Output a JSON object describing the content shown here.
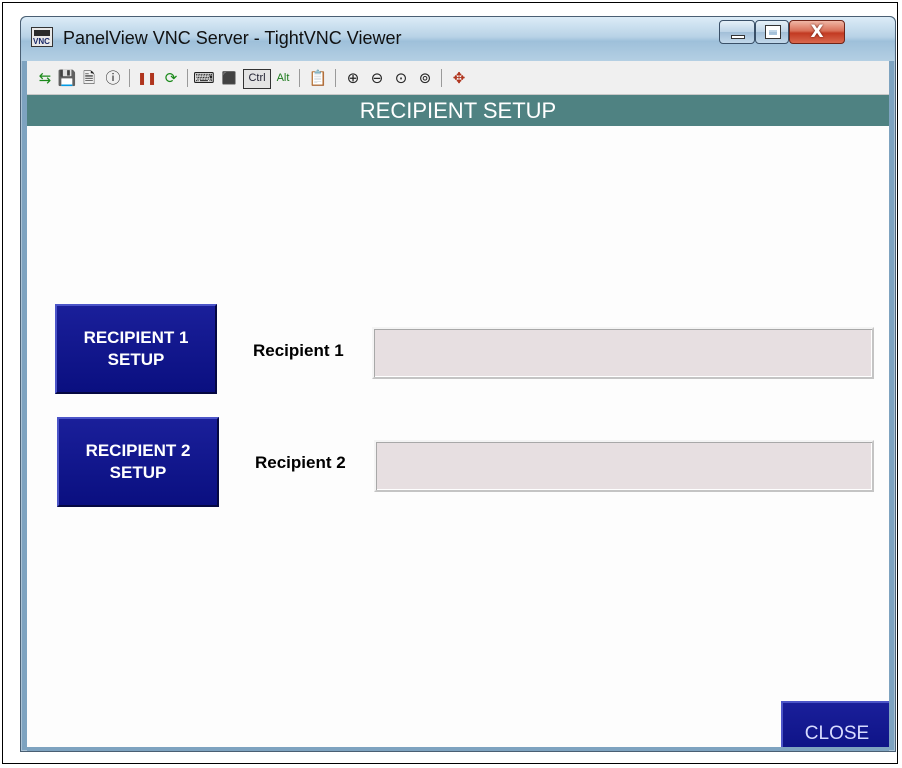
{
  "window": {
    "title": "PanelView VNC Server - TightVNC Viewer",
    "app_icon_text": "VNC",
    "close_glyph": "X"
  },
  "toolbar": {
    "items": [
      {
        "name": "new-connection-icon",
        "glyph": "⇆"
      },
      {
        "name": "save-icon",
        "glyph": "💾"
      },
      {
        "name": "options-icon",
        "glyph": "🗎"
      },
      {
        "name": "connection-info-icon",
        "glyph": "ⓘ"
      },
      {
        "name": "pause-icon",
        "glyph": "❚❚"
      },
      {
        "name": "refresh-icon",
        "glyph": "⟳"
      },
      {
        "name": "ctrl-alt-del-icon",
        "glyph": "⌨"
      },
      {
        "name": "send-keys-icon",
        "glyph": "⬛"
      },
      {
        "name": "ctrl-key-button",
        "glyph": "Ctrl"
      },
      {
        "name": "alt-key-button",
        "glyph": "Alt"
      },
      {
        "name": "clipboard-icon",
        "glyph": "📋"
      },
      {
        "name": "zoom-in-icon",
        "glyph": "⊕"
      },
      {
        "name": "zoom-out-icon",
        "glyph": "⊖"
      },
      {
        "name": "zoom-100-icon",
        "glyph": "⊙"
      },
      {
        "name": "zoom-auto-icon",
        "glyph": "⊚"
      },
      {
        "name": "fullscreen-icon",
        "glyph": "✥"
      }
    ]
  },
  "screen": {
    "header": "RECIPIENT SETUP",
    "recipient1": {
      "button_line1": "RECIPIENT 1",
      "button_line2": "SETUP",
      "label": "Recipient 1",
      "value": ""
    },
    "recipient2": {
      "button_line1": "RECIPIENT 2",
      "button_line2": "SETUP",
      "label": "Recipient 2",
      "value": ""
    },
    "close_label": "CLOSE"
  },
  "colors": {
    "header_bg": "#4f8282",
    "button_bg": "#10169a",
    "field_bg": "#e7dfe1"
  }
}
